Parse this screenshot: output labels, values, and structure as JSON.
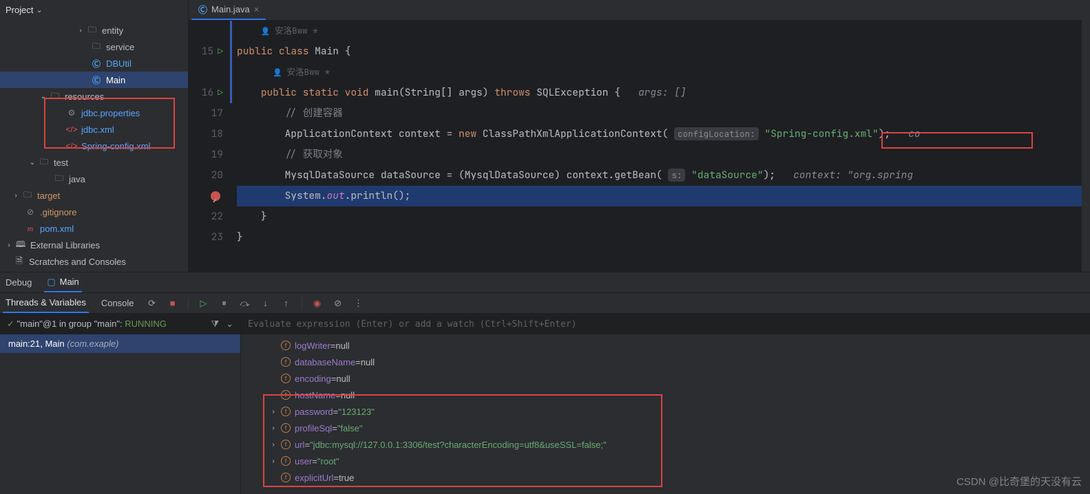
{
  "project": {
    "title": "Project",
    "tree": {
      "entity": {
        "label": "entity"
      },
      "service": {
        "label": "service"
      },
      "dbutil": {
        "label": "DBUtil"
      },
      "main": {
        "label": "Main"
      },
      "resources": {
        "label": "resources"
      },
      "jdbcprops": {
        "label": "jdbc.properties"
      },
      "jdbcxml": {
        "label": "jdbc.xml"
      },
      "springcfg": {
        "label": "Spring-config.xml"
      },
      "test": {
        "label": "test"
      },
      "java": {
        "label": "java"
      },
      "target": {
        "label": "target"
      },
      "gitignore": {
        "label": ".gitignore"
      },
      "pomxml": {
        "label": "pom.xml"
      },
      "extlib": {
        "label": "External Libraries"
      },
      "scratches": {
        "label": "Scratches and Consoles"
      }
    }
  },
  "editor": {
    "tab": {
      "label": "Main.java"
    },
    "author": "安洛Bww *",
    "code": {
      "l15": {
        "kw1": "public",
        "kw2": "class",
        "name": "Main",
        "brace": "{"
      },
      "l16": {
        "kw1": "public",
        "kw2": "static",
        "kw3": "void",
        "fn": "main",
        "params": "(String[] args)",
        "throws": "throws",
        "exc": "SQLException",
        "brace": "{",
        "hint": "args: []"
      },
      "l17": {
        "comment": "// 创建容器"
      },
      "l18": {
        "t1": "ApplicationContext",
        "v1": "context",
        "eq": "=",
        "new": "new",
        "t2": "ClassPathXmlApplicationContext",
        "hint": "configLocation:",
        "str": "\"Spring-config.xml\"",
        "tail": ");",
        "hint2": "co"
      },
      "l19": {
        "comment": "// 获取对象"
      },
      "l20": {
        "t1": "MysqlDataSource",
        "v1": "dataSource",
        "eq": "=",
        "cast": "(MysqlDataSource)",
        "expr": "context.getBean(",
        "hint": "s:",
        "str": "\"dataSource\"",
        "tail": ");",
        "hint2": "context: \"org.spring"
      },
      "l21": {
        "expr1": "System.",
        "out": "out",
        "expr2": ".println();"
      },
      "l22": {
        "brace": "}"
      },
      "l23": {
        "brace": "}"
      }
    }
  },
  "debug": {
    "tabs": {
      "debug": "Debug",
      "main": "Main"
    },
    "subtabs": {
      "tv": "Threads & Variables",
      "console": "Console"
    },
    "frames": {
      "header_pre": "\"main\"@1 in group \"main\": ",
      "header_status": "RUNNING",
      "frame0": {
        "label": "main:21, Main ",
        "pkg": "(com.exaple)"
      }
    },
    "eval_placeholder": "Evaluate expression (Enter) or add a watch (Ctrl+Shift+Enter)",
    "vars": [
      {
        "name": "logWriter",
        "val": "null",
        "exp": false
      },
      {
        "name": "databaseName",
        "val": "null",
        "exp": false
      },
      {
        "name": "encoding",
        "val": "null",
        "exp": false
      },
      {
        "name": "hostName",
        "val": "null",
        "exp": false
      },
      {
        "name": "password",
        "val": "\"123123\"",
        "str": true,
        "exp": true
      },
      {
        "name": "profileSql",
        "val": "\"false\"",
        "str": true,
        "exp": true
      },
      {
        "name": "url",
        "val": "\"jdbc:mysql://127.0.0.1:3306/test?characterEncoding=utf8&useSSL=false;\"",
        "str": true,
        "exp": true
      },
      {
        "name": "user",
        "val": "\"root\"",
        "str": true,
        "exp": true
      },
      {
        "name": "explicitUrl",
        "val": "true",
        "exp": false
      }
    ]
  },
  "watermark": "CSDN @比奇堡的天没有云"
}
